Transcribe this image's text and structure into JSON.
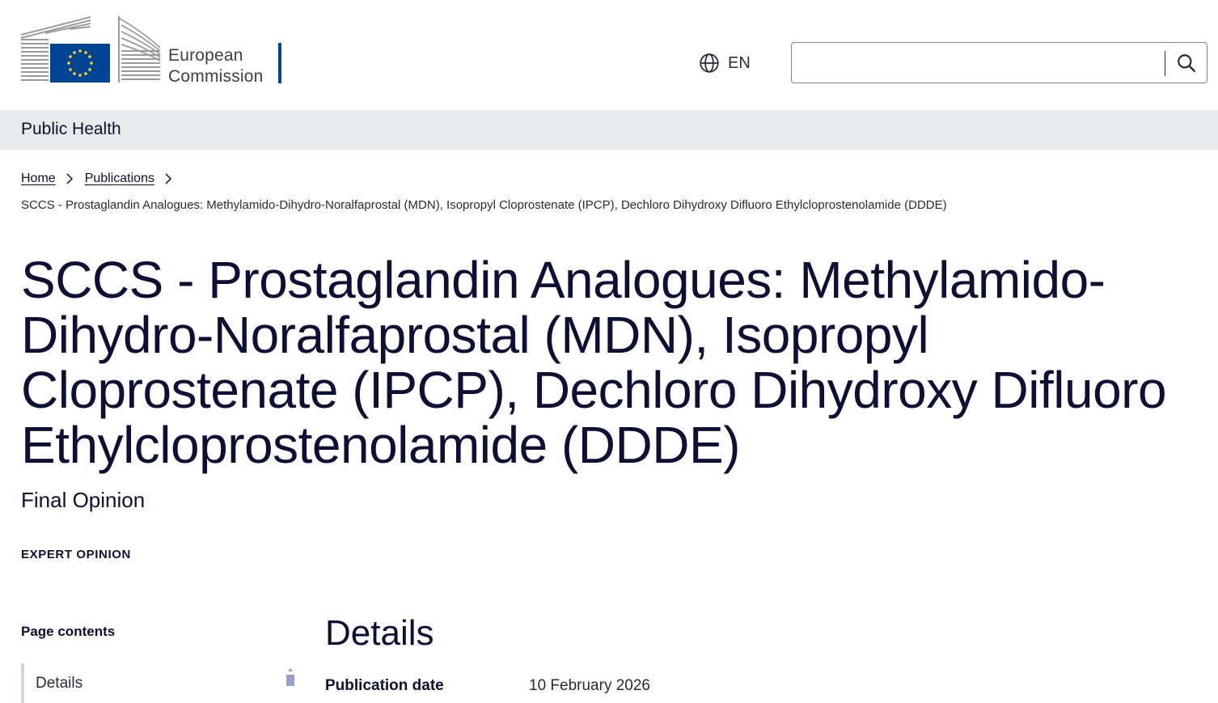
{
  "header": {
    "logo_line1": "European",
    "logo_line2": "Commission",
    "language": "EN",
    "search_placeholder": "",
    "colors": {
      "eu_blue": "#004494",
      "eu_yellow": "#ffd617"
    }
  },
  "site": {
    "name": "Public Health"
  },
  "breadcrumb": {
    "items": [
      "Home",
      "Publications"
    ],
    "current": "SCCS - Prostaglandin Analogues: Methylamido-Dihydro-Noralfaprostal (MDN), Isopropyl Cloprostenate (IPCP), Dechloro Dihydroxy Difluoro Ethylcloprostenolamide (DDDE)"
  },
  "page": {
    "title": "SCCS - Prostaglandin Analogues: Methylamido-Dihydro-Noralfaprostal (MDN), Isopropyl Cloprostenate (IPCP), Dechloro Dihydroxy Difluoro Ethylcloprostenolamide (DDDE)",
    "subtitle": "Final Opinion",
    "meta": "EXPERT OPINION"
  },
  "toc": {
    "title": "Page contents",
    "items": [
      "Details"
    ]
  },
  "details": {
    "heading": "Details",
    "publication_date_label": "Publication date",
    "publication_date_value": "10 February 2026"
  },
  "icons": [
    "eu-logo-icon",
    "globe-icon",
    "search-icon",
    "chevron-right-icon",
    "scroll-up-icon"
  ]
}
